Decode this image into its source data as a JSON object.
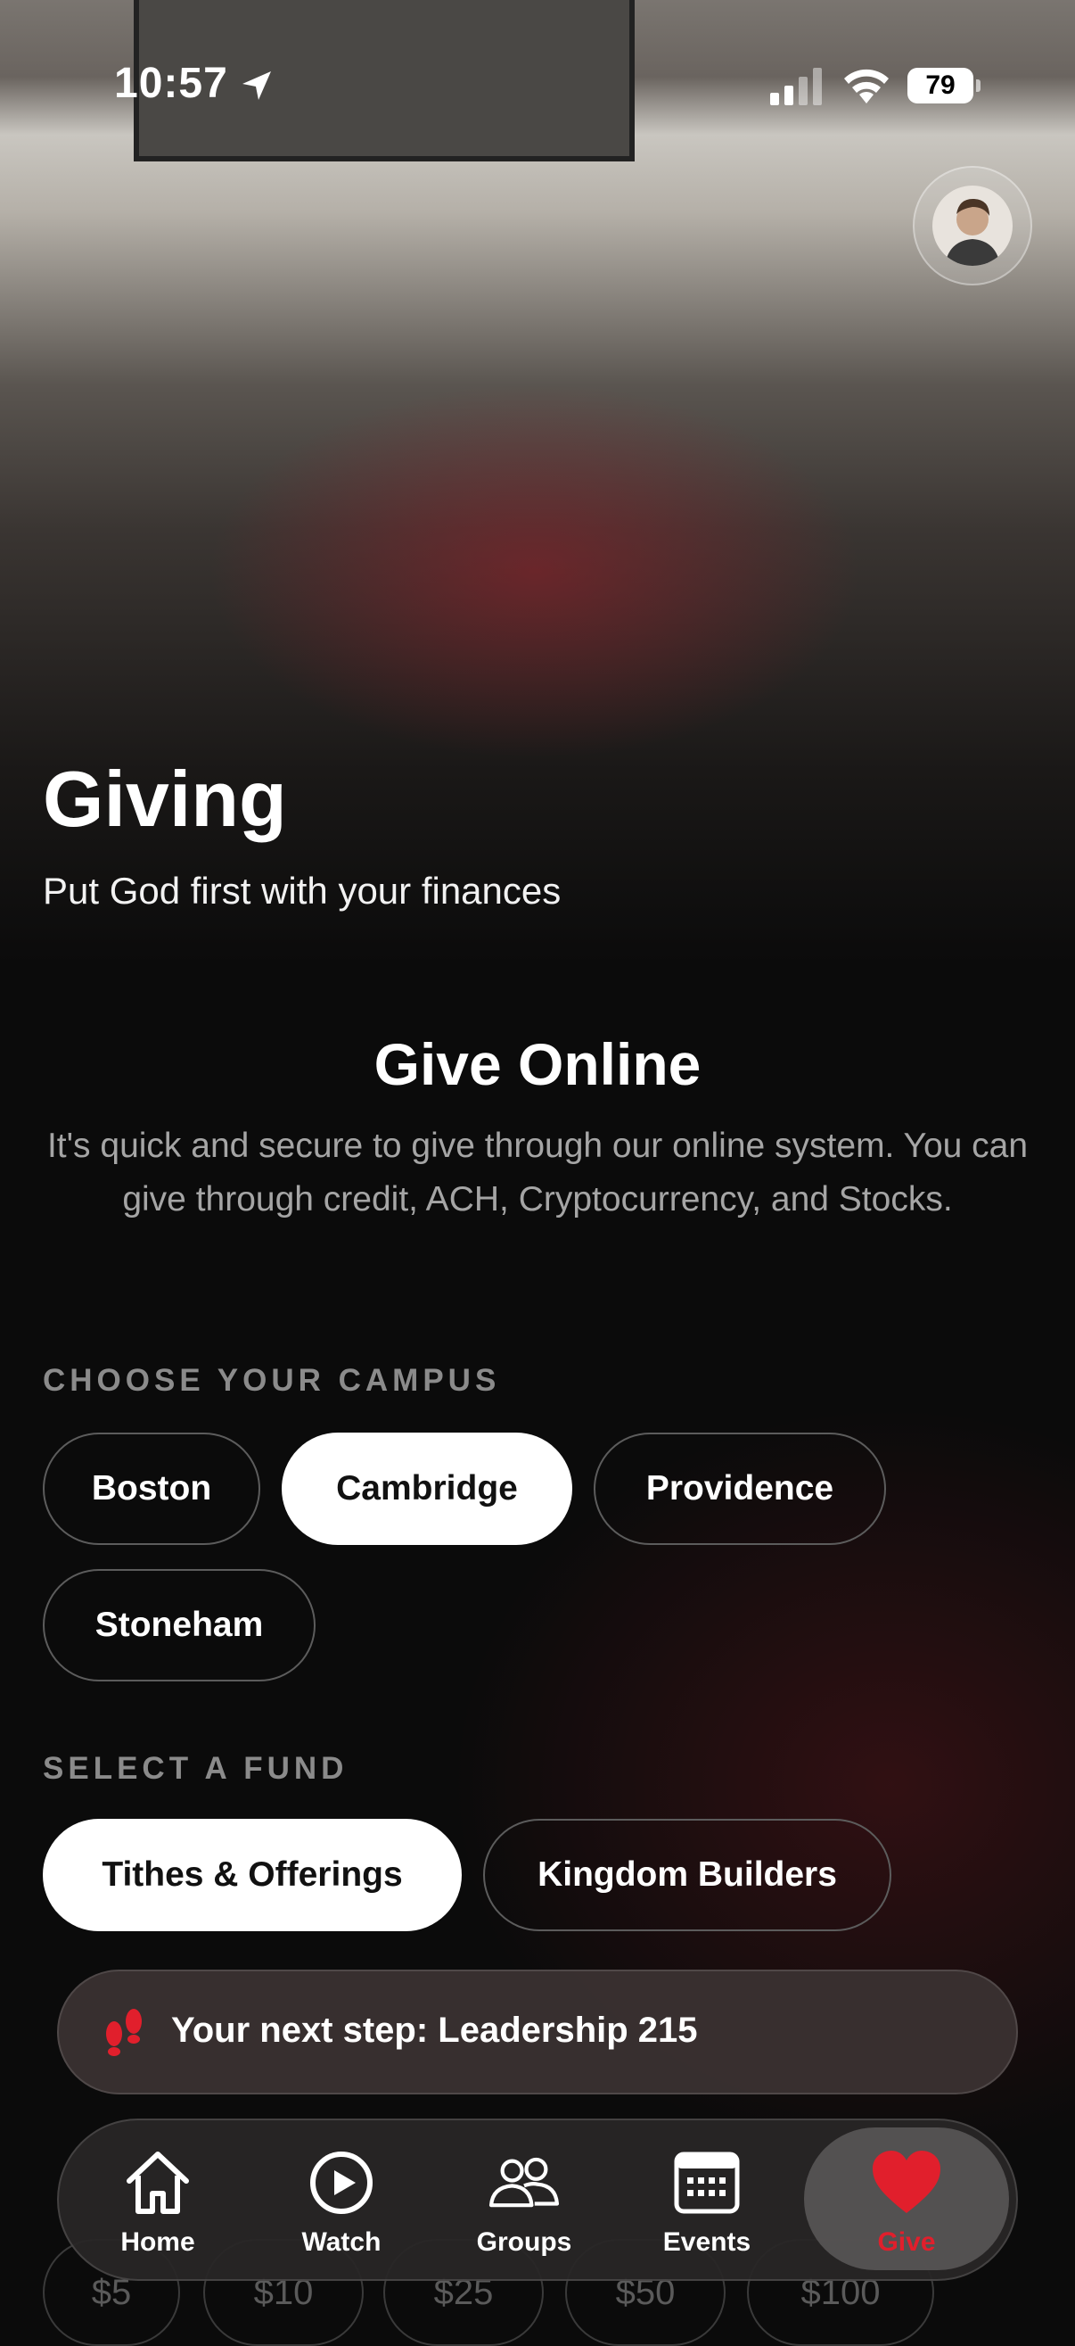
{
  "status_bar": {
    "time": "10:57",
    "battery": "79"
  },
  "hero": {
    "title": "Giving",
    "subtitle": "Put God first with your finances"
  },
  "give_online": {
    "title": "Give Online",
    "description": "It's quick and secure to give through our online system. You can give through credit, ACH, Cryptocurrency, and Stocks."
  },
  "campus": {
    "label": "CHOOSE YOUR CAMPUS",
    "options": [
      "Boston",
      "Cambridge",
      "Providence",
      "Stoneham"
    ],
    "selected": "Cambridge"
  },
  "fund": {
    "label": "SELECT A FUND",
    "options": [
      "Tithes & Offerings",
      "Kingdom Builders"
    ],
    "selected": "Tithes & Offerings"
  },
  "amounts": [
    "$5",
    "$10",
    "$25",
    "$50",
    "$100"
  ],
  "next_step": {
    "text": "Your next step: Leadership 215"
  },
  "tabbar": {
    "items": [
      {
        "label": "Home",
        "icon": "home-icon"
      },
      {
        "label": "Watch",
        "icon": "play-icon"
      },
      {
        "label": "Groups",
        "icon": "groups-icon"
      },
      {
        "label": "Events",
        "icon": "calendar-icon"
      },
      {
        "label": "Give",
        "icon": "heart-icon"
      }
    ],
    "active": "Give"
  },
  "colors": {
    "accent": "#e11f2c",
    "background": "#0b0b0b",
    "chip_selected": "#ffffff"
  }
}
